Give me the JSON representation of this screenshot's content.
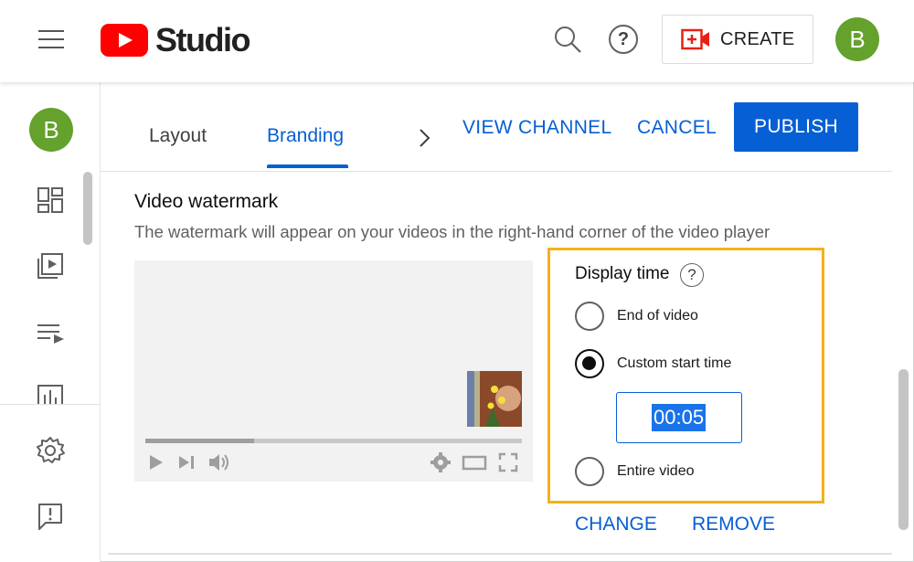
{
  "app": {
    "logo_text": "Studio",
    "create_label": "CREATE",
    "avatar_letter": "B"
  },
  "sidebar": {
    "avatar_letter": "B",
    "items": [
      {
        "icon": "dashboard-icon"
      },
      {
        "icon": "content-icon"
      },
      {
        "icon": "playlists-icon"
      },
      {
        "icon": "analytics-icon"
      },
      {
        "icon": "settings-icon"
      },
      {
        "icon": "feedback-icon"
      }
    ]
  },
  "tabs": [
    {
      "label": "Layout",
      "active": false
    },
    {
      "label": "Branding",
      "active": true
    }
  ],
  "actions": {
    "view_channel": "VIEW CHANNEL",
    "cancel": "CANCEL",
    "publish": "PUBLISH"
  },
  "watermark": {
    "title": "Video watermark",
    "description": "The watermark will appear on your videos in the right-hand corner of the video player",
    "progress_fraction": 0.29,
    "display_time": {
      "title": "Display time",
      "help": "?",
      "options": [
        {
          "label": "End of video",
          "selected": false
        },
        {
          "label": "Custom start time",
          "selected": true
        },
        {
          "label": "Entire video",
          "selected": false
        }
      ],
      "custom_start_value": "00:05"
    },
    "change_label": "CHANGE",
    "remove_label": "REMOVE"
  },
  "colors": {
    "accent": "#065fd4",
    "highlight_border": "#f2b21b",
    "avatar": "#64a12d",
    "logo_red": "#ff0000"
  }
}
